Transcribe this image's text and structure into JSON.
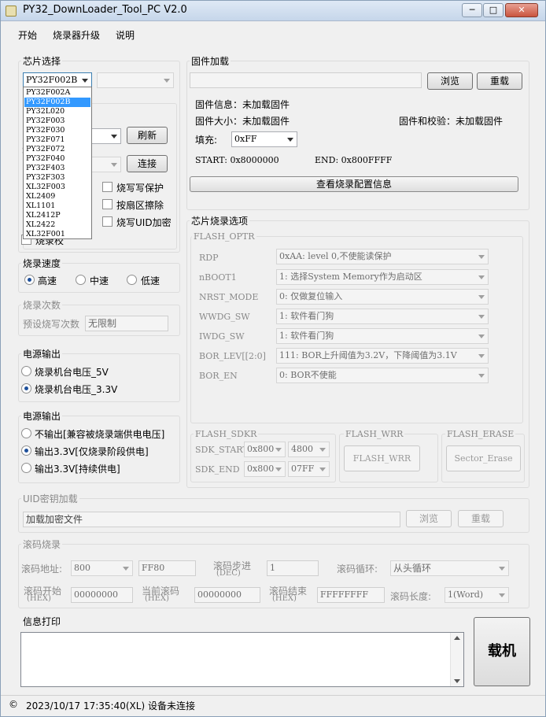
{
  "window": {
    "title": "PY32_DownLoader_Tool_PC V2.0",
    "min": "─",
    "max": "□",
    "close": "✕"
  },
  "menu": [
    "开始",
    "烧录器升级",
    "说明"
  ],
  "chip": {
    "group_title": "芯片选择",
    "selected": "PY32F002B",
    "options": [
      "PY32F002A",
      "PY32F002B",
      "PY32L020",
      "PY32F003",
      "PY32F030",
      "PY32F071",
      "PY32F072",
      "PY32F040",
      "PY32F403",
      "PY32F303",
      "XL32F003",
      "XL2409",
      "XL1101",
      "XL2412P",
      "XL2422",
      "XL32F001"
    ],
    "refresh": "刷新",
    "connect": "连接",
    "write_protect": "烧写写保护",
    "sector_erase": "按扇区擦除",
    "uid_encrypt": "烧写UID加密",
    "partial_text": "烧录校",
    "partial_letter": "S"
  },
  "firmware": {
    "group_title": "固件加载",
    "browse": "浏览",
    "reload": "重载",
    "info": "固件信息：未加载固件",
    "size": "固件大小：未加载固件",
    "checksum": "固件和校验：未加载固件",
    "fill_label": "填充:",
    "fill_value": "0xFF",
    "start": "START: 0x8000000",
    "end": "END: 0x800FFFF",
    "view_config": "查看烧录配置信息"
  },
  "speed": {
    "title": "烧录速度",
    "options": [
      "高速",
      "中速",
      "低速"
    ],
    "selected": 0
  },
  "count": {
    "title": "烧录次数",
    "label": "预设烧写次数",
    "value": "无限制"
  },
  "power1": {
    "title": "电源输出",
    "options": [
      "烧录机台电压_5V",
      "烧录机台电压_3.3V"
    ],
    "selected": 1
  },
  "power2": {
    "title": "电源输出",
    "options": [
      "不输出[兼容被烧录端供电电压]",
      "输出3.3V[仅烧录阶段供电]",
      "输出3.3V[持续供电]"
    ],
    "selected": 1
  },
  "options": {
    "title": "芯片烧录选项",
    "optr_title": "FLASH_OPTR",
    "rows": [
      {
        "label": "RDP",
        "value": "0xAA: level 0,不使能读保护"
      },
      {
        "label": "nBOOT1",
        "value": "1: 选择System Memory作为启动区"
      },
      {
        "label": "NRST_MODE",
        "value": "0: 仅做复位输入"
      },
      {
        "label": "WWDG_SW",
        "value": "1: 软件看门狗"
      },
      {
        "label": "IWDG_SW",
        "value": "1: 软件看门狗"
      },
      {
        "label": "BOR_LEV[[2:0]",
        "value": "111: BOR上升阈值为3.2V，下降阈值为3.1V"
      },
      {
        "label": "BOR_EN",
        "value": "0: BOR不使能"
      }
    ],
    "sdkr_title": "FLASH_SDKR",
    "sdk_start_label": "SDK_START",
    "sdk_start_a": "0x800",
    "sdk_start_b": "4800",
    "sdk_end_label": "SDK_END",
    "sdk_end_a": "0x800",
    "sdk_end_b": "07FF",
    "wrr_title": "FLASH_WRR",
    "wrr_button": "FLASH_WRR",
    "erase_title": "FLASH_ERASE",
    "erase_button": "Sector_Erase"
  },
  "uid": {
    "title": "UID密钥加载",
    "placeholder": "加载加密文件",
    "browse": "浏览",
    "reload": "重载"
  },
  "rolling": {
    "title": "滚码烧录",
    "addr_label": "滚码地址:",
    "addr_value": "800",
    "addr_hex": "FF80",
    "step_label1": "滚码步进",
    "step_label2": "(DEC)",
    "step_value": "1",
    "loop_label": "滚码循环:",
    "loop_value": "从头循环",
    "start_label1": "滚码开始",
    "start_label2": "(HEX)",
    "start_value": "00000000",
    "current_label1": "当前滚码",
    "current_label2": "(HEX)",
    "current_value": "00000000",
    "end_label1": "滚码结束",
    "end_label2": "(HEX)",
    "end_value": "FFFFFFFF",
    "len_label": "滚码长度:",
    "len_value": "1(Word)"
  },
  "log": {
    "title": "信息打印"
  },
  "load_button": "载机",
  "status": {
    "copyright": "©",
    "text": "2023/10/17 17:35:40(XL)  设备未连接"
  }
}
